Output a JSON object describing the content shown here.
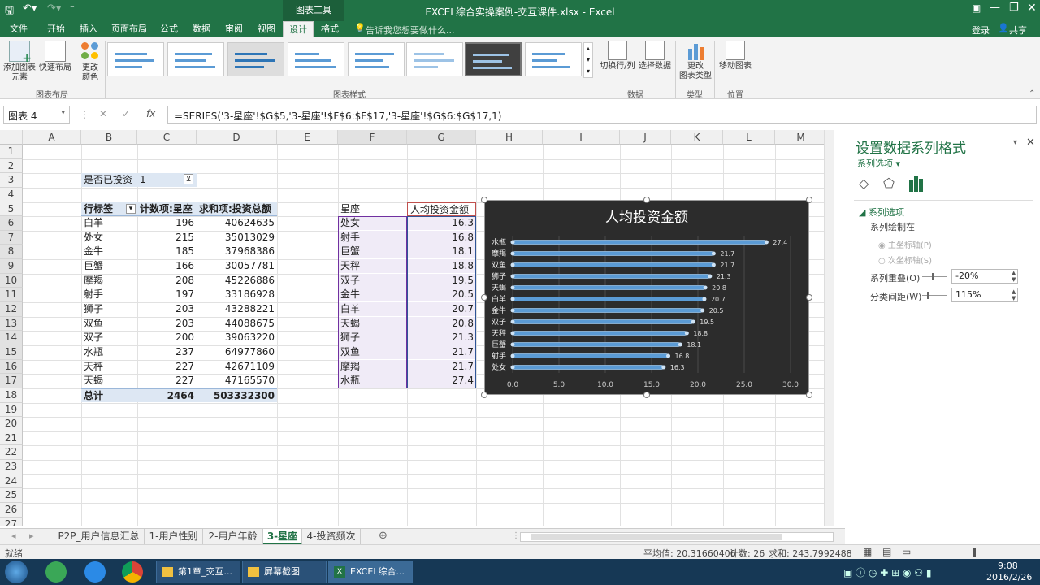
{
  "titlebar": {
    "title": "EXCEL综合实操案例-交互课件.xlsx - Excel",
    "context_tab": "图表工具"
  },
  "tabs": [
    "文件",
    "开始",
    "插入",
    "页面布局",
    "公式",
    "数据",
    "审阅",
    "视图",
    "设计",
    "格式"
  ],
  "tellme": "告诉我您想要做什么...",
  "account": {
    "login": "登录",
    "share": "共享"
  },
  "ribbon": {
    "add_element": "添加图表\n元素",
    "quick_layout": "快速布局",
    "change_color": "更改\n颜色",
    "group_layout": "图表布局",
    "group_styles": "图表样式",
    "switch_rowcol": "切换行/列",
    "select_data": "选择数据",
    "group_data": "数据",
    "change_type": "更改\n图表类型",
    "group_type": "类型",
    "move_chart": "移动图表",
    "group_location": "位置"
  },
  "formula_bar": {
    "name_box": "图表 4",
    "formula": "=SERIES('3-星座'!$G$5,'3-星座'!$F$6:$F$17,'3-星座'!$G$6:$G$17,1)",
    "fx": "fx"
  },
  "columns": [
    "A",
    "B",
    "C",
    "D",
    "E",
    "F",
    "G",
    "H",
    "I",
    "J",
    "K",
    "L",
    "M"
  ],
  "rows": [
    "1",
    "2",
    "3",
    "4",
    "5",
    "6",
    "7",
    "8",
    "9",
    "10",
    "11",
    "12",
    "13",
    "14",
    "15",
    "16",
    "17",
    "18",
    "19",
    "20",
    "21",
    "22",
    "23",
    "24",
    "25",
    "26",
    "27"
  ],
  "pivot": {
    "filter_label": "是否已投资",
    "filter_value": "1",
    "headers": [
      "行标签",
      "计数项:星座",
      "求和项:投资总额"
    ],
    "rows": [
      [
        "白羊",
        "196",
        "40624635"
      ],
      [
        "处女",
        "215",
        "35013029"
      ],
      [
        "金牛",
        "185",
        "37968386"
      ],
      [
        "巨蟹",
        "166",
        "30057781"
      ],
      [
        "摩羯",
        "208",
        "45226886"
      ],
      [
        "射手",
        "197",
        "33186928"
      ],
      [
        "狮子",
        "203",
        "43288221"
      ],
      [
        "双鱼",
        "203",
        "44088675"
      ],
      [
        "双子",
        "200",
        "39063220"
      ],
      [
        "水瓶",
        "237",
        "64977860"
      ],
      [
        "天秤",
        "227",
        "42671109"
      ],
      [
        "天蝎",
        "227",
        "47165570"
      ]
    ],
    "total": [
      "总计",
      "2464",
      "503332300"
    ]
  },
  "table2": {
    "headers": [
      "星座",
      "人均投资金额"
    ],
    "rows": [
      [
        "处女",
        "16.3"
      ],
      [
        "射手",
        "16.8"
      ],
      [
        "巨蟹",
        "18.1"
      ],
      [
        "天秤",
        "18.8"
      ],
      [
        "双子",
        "19.5"
      ],
      [
        "金牛",
        "20.5"
      ],
      [
        "白羊",
        "20.7"
      ],
      [
        "天蝎",
        "20.8"
      ],
      [
        "狮子",
        "21.3"
      ],
      [
        "双鱼",
        "21.7"
      ],
      [
        "摩羯",
        "21.7"
      ],
      [
        "水瓶",
        "27.4"
      ]
    ]
  },
  "chart_data": {
    "type": "bar",
    "orientation": "horizontal",
    "title": "人均投资金额",
    "categories": [
      "处女",
      "射手",
      "巨蟹",
      "天秤",
      "双子",
      "金牛",
      "白羊",
      "天蝎",
      "狮子",
      "双鱼",
      "摩羯",
      "水瓶"
    ],
    "values": [
      16.3,
      16.8,
      18.1,
      18.8,
      19.5,
      20.5,
      20.7,
      20.8,
      21.3,
      21.7,
      21.7,
      27.4
    ],
    "xlim": [
      0,
      30
    ],
    "xticks": [
      "0.0",
      "5.0",
      "10.0",
      "15.0",
      "20.0",
      "25.0",
      "30.0"
    ],
    "grid": true,
    "bar_color": "#5b9bd5",
    "background": "#2c2c2c"
  },
  "pane": {
    "title": "设置数据系列格式",
    "subtitle": "系列选项",
    "section": "系列选项",
    "plot_on": "系列绘制在",
    "primary_axis": "主坐标轴(P)",
    "secondary_axis": "次坐标轴(S)",
    "overlap_label": "系列重叠(O)",
    "overlap_value": "-20%",
    "gap_label": "分类间距(W)",
    "gap_value": "115%"
  },
  "sheets": [
    "P2P_用户信息汇总",
    "1-用户性别",
    "2-用户年龄",
    "3-星座",
    "4-投资频次"
  ],
  "active_sheet": "3-星座",
  "status": {
    "ready": "就绪",
    "average": "平均值: 20.31660406",
    "count": "计数: 26",
    "sum": "求和: 243.7992488"
  },
  "taskbar": {
    "items": [
      "第1章_交互...",
      "屏幕截图",
      "EXCEL综合..."
    ],
    "time": "9:08",
    "date": "2016/2/26"
  }
}
